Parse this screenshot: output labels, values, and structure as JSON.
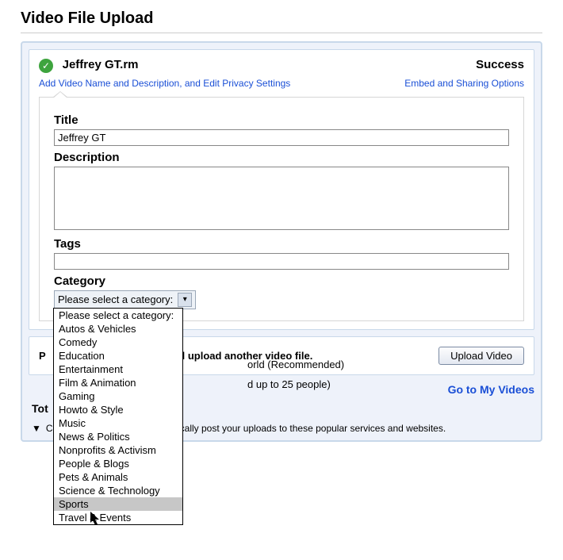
{
  "page_title": "Video File Upload",
  "file": {
    "name": "Jeffrey GT.rm",
    "status": "Success"
  },
  "links": {
    "edit": "Add Video Name and Description, and Edit Privacy Settings",
    "embed": "Embed and Sharing Options"
  },
  "form": {
    "title_label": "Title",
    "title_value": "Jeffrey GT",
    "desc_label": "Description",
    "desc_value": "",
    "tags_label": "Tags",
    "tags_value": "",
    "cat_label": "Category",
    "cat_selected": "Please select a category:"
  },
  "category_options": [
    "Please select a category:",
    "Autos & Vehicles",
    "Comedy",
    "Education",
    "Entertainment",
    "Film & Animation",
    "Gaming",
    "Howto & Style",
    "Music",
    "News & Politics",
    "Nonprofits & Activism",
    "People & Blogs",
    "Pets & Animals",
    "Science & Technology",
    "Sports",
    "Travel & Events"
  ],
  "category_highlight_index": 14,
  "hidden_text": {
    "a": "orld (Recommended)",
    "b": "d up to 25 people)"
  },
  "upload_again": {
    "prompt_prefix": "P",
    "prompt_suffix": "elect and upload another video file.",
    "button": "Upload Video"
  },
  "go_my_videos": "Go to My Videos",
  "tot_label": "Tot",
  "autoshare": "Connect accounts and automatically post your uploads to these popular services and websites."
}
